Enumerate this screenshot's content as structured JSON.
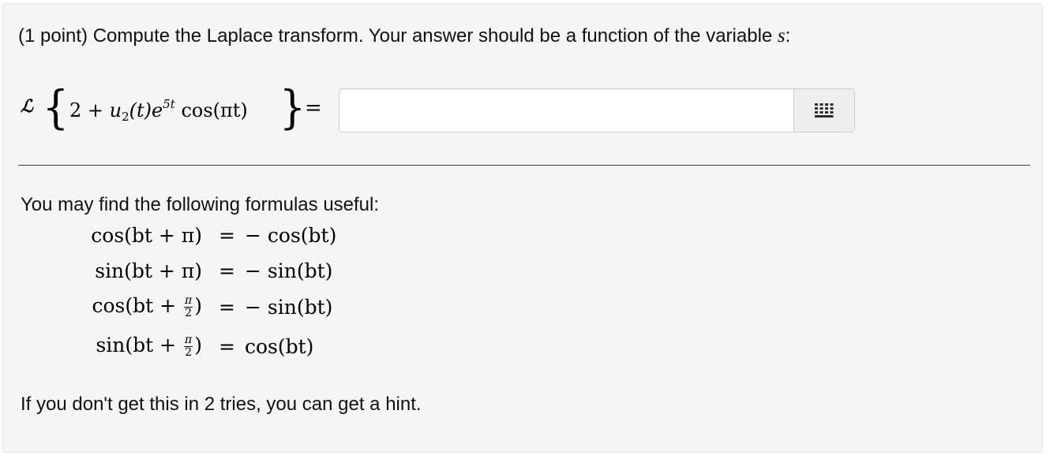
{
  "problem": {
    "prompt_text": "(1 point) Compute the Laplace transform. Your answer should be a function of the variable ",
    "prompt_variable": "s",
    "prompt_end": ":"
  },
  "expression": {
    "operator": "ℒ",
    "left_brace": "{",
    "right_brace": "}",
    "constant": "2 + ",
    "step_func": "u",
    "step_sub": "2",
    "step_arg": "(t)e",
    "exp_power": "5t",
    "cos_part": " cos(πt)",
    "equals": "="
  },
  "answer_input": {
    "value": "",
    "placeholder": ""
  },
  "formulas": {
    "heading": "You may find the following formulas useful:",
    "rows": [
      {
        "lhs_a": "cos(bt + π)",
        "lhs_frac": "",
        "lhs_b": "",
        "eq": "=",
        "rhs": "− cos(bt)"
      },
      {
        "lhs_a": "sin(bt + π)",
        "lhs_frac": "",
        "lhs_b": "",
        "eq": "=",
        "rhs": "− sin(bt)"
      },
      {
        "lhs_a": "cos(bt + ",
        "lhs_frac_num": "π",
        "lhs_frac_den": "2",
        "lhs_b": ")",
        "eq": "=",
        "rhs": "− sin(bt)"
      },
      {
        "lhs_a": "sin(bt + ",
        "lhs_frac_num": "π",
        "lhs_frac_den": "2",
        "lhs_b": ")",
        "eq": "=",
        "rhs": "cos(bt)"
      }
    ]
  },
  "hint": {
    "text": "If you don't get this in 2 tries, you can get a hint."
  },
  "icons": {
    "equation_editor": "grid-icon"
  },
  "colors": {
    "panel_bg": "#f5f5f5",
    "text": "#111111",
    "button_bg": "#eeeeee",
    "icon": "#2b2b2b"
  }
}
